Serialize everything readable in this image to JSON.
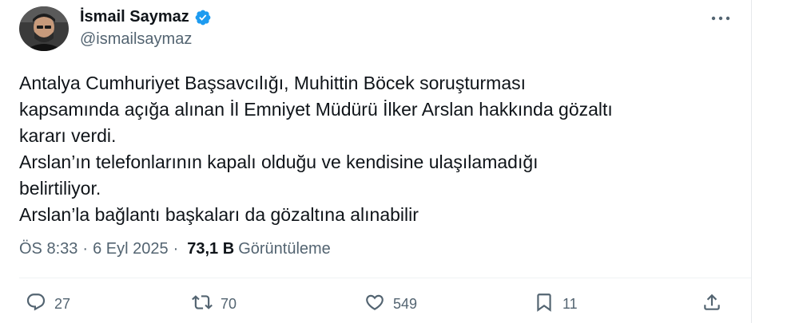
{
  "author": {
    "display_name": "İsmail Saymaz",
    "handle": "@ismailsaymaz",
    "verified": true
  },
  "tweet": {
    "lines": [
      "Antalya Cumhuriyet Başsavcılığı, Muhittin Böcek soruşturması",
      "kapsamında açığa alınan İl Emniyet Müdürü İlker Arslan hakkında gözaltı",
      "kararı verdi.",
      "Arslan’ın telefonlarının kapalı olduğu ve kendisine ulaşılamadığı",
      "belirtiliyor.",
      "Arslan’la bağlantı başkaları da gözaltına alınabilir"
    ]
  },
  "meta": {
    "time": "ÖS 8:33",
    "separator": "·",
    "date": "6 Eyl 2025",
    "views_count": "73,1 B",
    "views_label": "Görüntüleme"
  },
  "actions": {
    "replies": "27",
    "reposts": "70",
    "likes": "549",
    "bookmarks": "11"
  },
  "icons": {
    "more": "more-options-icon",
    "verified": "verified-badge-icon",
    "reply": "reply-icon",
    "repost": "repost-icon",
    "like": "like-icon",
    "bookmark": "bookmark-icon",
    "share": "share-icon"
  },
  "colors": {
    "verified": "#1d9bf0",
    "text": "#0f1419",
    "secondary": "#536471"
  }
}
